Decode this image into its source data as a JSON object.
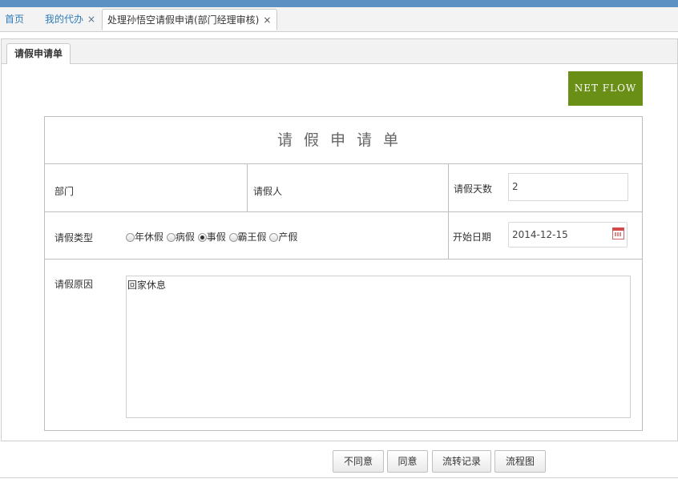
{
  "tabs": [
    {
      "label": "首页",
      "closable": false,
      "active": false
    },
    {
      "label": "我的代办",
      "closable": true,
      "active": false
    },
    {
      "label": "处理孙悟空请假申请(部门经理审核)",
      "closable": true,
      "active": true
    }
  ],
  "close_glyph": "×",
  "panel_tab": "请假申请单",
  "brand_button": "NET FLOW",
  "form": {
    "title": "请假申请单",
    "department_label": "部门",
    "department_value": "",
    "applicant_label": "请假人",
    "applicant_value": "",
    "days_label": "请假天数",
    "days_value": "2",
    "leave_type_label": "请假类型",
    "leave_types": [
      {
        "label": "年休假",
        "checked": false
      },
      {
        "label": "病假",
        "checked": false
      },
      {
        "label": "事假",
        "checked": true
      },
      {
        "label": "霸王假",
        "checked": false
      },
      {
        "label": "产假",
        "checked": false
      }
    ],
    "start_date_label": "开始日期",
    "start_date_value": "2014-12-15",
    "reason_label": "请假原因",
    "reason_value": "回家休息"
  },
  "actions": {
    "reject": "不同意",
    "approve": "同意",
    "history": "流转记录",
    "diagram": "流程图"
  },
  "colors": {
    "top_bar": "#5b91c3",
    "tab_link": "#2f7cb9",
    "brand_button": "#6a8f16",
    "calendar_icon": "#d24a4a"
  }
}
